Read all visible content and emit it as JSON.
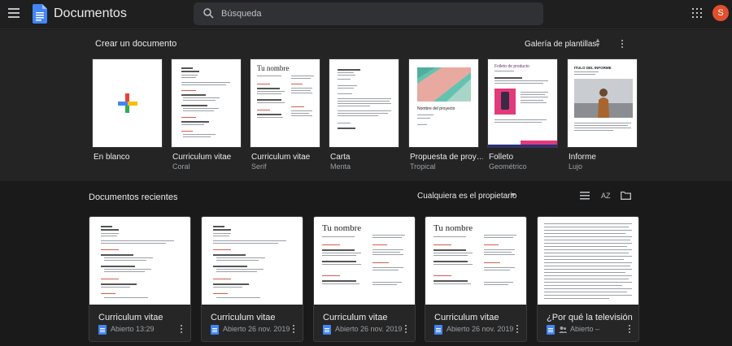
{
  "app": {
    "title": "Documentos",
    "avatar_initial": "S",
    "avatar_color": "#e0502d",
    "accent": "#4285f4"
  },
  "search": {
    "placeholder": "Búsqueda"
  },
  "templates": {
    "title": "Crear un documento",
    "gallery_label": "Galería de plantillas",
    "items": [
      {
        "name": "En blanco",
        "sub": "",
        "icon": "plus-icon"
      },
      {
        "name": "Curriculum vitae",
        "sub": "Coral",
        "heading": ""
      },
      {
        "name": "Curriculum vitae",
        "sub": "Serif",
        "heading": "Tu nombre"
      },
      {
        "name": "Carta",
        "sub": "Menta",
        "heading": ""
      },
      {
        "name": "Propuesta de proy…",
        "sub": "Tropical",
        "heading": "Nombre del proyecto"
      },
      {
        "name": "Folleto",
        "sub": "Geométrico",
        "heading": "Folleto de producto"
      },
      {
        "name": "Informe",
        "sub": "Lujo",
        "heading": "ÍTULO DEL INFORME"
      }
    ]
  },
  "recent": {
    "title": "Documentos recientes",
    "owner_filter": "Cualquiera es el propietario",
    "sort_label": "AZ",
    "docs": [
      {
        "title": "Curriculum vitae",
        "meta": "Abierto 13:29",
        "preview_heading": ""
      },
      {
        "title": "Curriculum vitae",
        "meta": "Abierto 26 nov. 2019",
        "preview_heading": ""
      },
      {
        "title": "Curriculum vitae",
        "meta": "Abierto 26 nov. 2019",
        "preview_heading": "Tu nombre"
      },
      {
        "title": "Curriculum vitae",
        "meta": "Abierto 26 nov. 2019",
        "preview_heading": "Tu nombre"
      },
      {
        "title": "¿Por qué la televisión es c…",
        "meta": "Abierto –",
        "preview_heading": ""
      }
    ]
  }
}
